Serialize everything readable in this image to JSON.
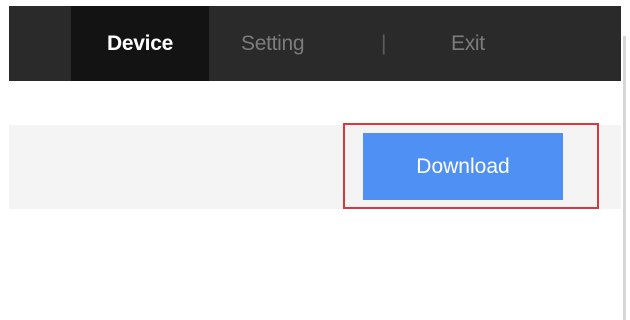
{
  "nav": {
    "items": [
      {
        "label": "Device",
        "active": true
      },
      {
        "label": "Setting",
        "active": false
      },
      {
        "label": "|",
        "active": false
      },
      {
        "label": "Exit",
        "active": false
      }
    ]
  },
  "toolbar": {
    "download_label": "Download"
  },
  "colors": {
    "nav_bg": "#2a2a2a",
    "nav_active_bg": "#131313",
    "nav_text": "#7c7c7c",
    "toolbar_bg": "#f4f4f4",
    "button_bg": "#4f90f5",
    "highlight_border": "#d8393d"
  }
}
